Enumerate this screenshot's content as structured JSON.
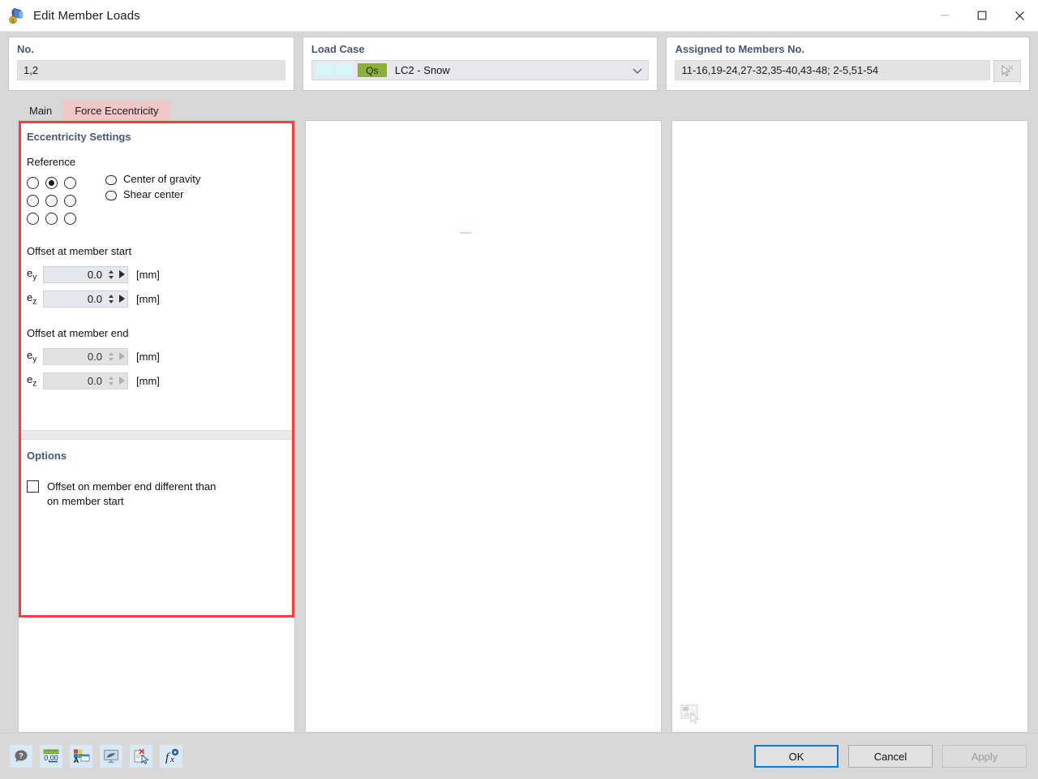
{
  "window": {
    "title": "Edit Member Loads",
    "icon": "member-load-icon",
    "minimize_label": "—",
    "maximize_label": "☐",
    "close_label": "✕"
  },
  "top": {
    "no": {
      "title": "No.",
      "value": "1,2"
    },
    "load_case": {
      "title": "Load Case",
      "badge": "Qs",
      "value": "LC2 - Snow",
      "arrow": "˅"
    },
    "members": {
      "title": "Assigned to Members No.",
      "value": "11-16,19-24,27-32,35-40,43-48; 2-5,51-54",
      "pick_icon": "select-members-cursor-icon"
    }
  },
  "tabs": [
    {
      "label": "Main",
      "selected": false
    },
    {
      "label": "Force Eccentricity",
      "selected": true
    }
  ],
  "eccentricity": {
    "section_title": "Eccentricity Settings",
    "reference_label": "Reference",
    "grid_selected_index": 1,
    "grid_cells": [
      {
        "selected": false
      },
      {
        "selected": true
      },
      {
        "selected": false
      },
      {
        "selected": false
      },
      {
        "selected": false
      },
      {
        "selected": false
      },
      {
        "selected": false
      },
      {
        "selected": false
      },
      {
        "selected": false
      }
    ],
    "reference_options": [
      {
        "label": "Center of gravity",
        "selected": false
      },
      {
        "label": "Shear center",
        "selected": false
      }
    ],
    "start": {
      "title": "Offset at member start",
      "rows": [
        {
          "label": "e",
          "sub": "y",
          "value": "0.0",
          "unit": "[mm]",
          "disabled": false
        },
        {
          "label": "e",
          "sub": "z",
          "value": "0.0",
          "unit": "[mm]",
          "disabled": false
        }
      ]
    },
    "end": {
      "title": "Offset at member end",
      "rows": [
        {
          "label": "e",
          "sub": "y",
          "value": "0.0",
          "unit": "[mm]",
          "disabled": true
        },
        {
          "label": "e",
          "sub": "z",
          "value": "0.0",
          "unit": "[mm]",
          "disabled": true
        }
      ]
    }
  },
  "options": {
    "section_title": "Options",
    "checkbox": {
      "label": "Offset on member end different than on member start",
      "checked": false
    }
  },
  "toolbar": [
    {
      "name": "help-icon",
      "title": "Help"
    },
    {
      "name": "units-decimal-icon",
      "title": "Units and Decimal Places"
    },
    {
      "name": "display-properties-icon",
      "title": "Display Properties"
    },
    {
      "name": "visualization-icon",
      "title": "Visualization"
    },
    {
      "name": "delete-selection-icon",
      "title": "Delete"
    },
    {
      "name": "formula-fx-icon",
      "title": "Formula"
    }
  ],
  "footer": {
    "ok": "OK",
    "cancel": "Cancel",
    "apply": "Apply"
  },
  "colors": {
    "accent_heading": "#46577a",
    "highlight_outline": "#f2403d",
    "tab_selected": "#f2c7c7",
    "load_case_badge": "#8cae3e",
    "focus_border": "#0a7cd4"
  }
}
